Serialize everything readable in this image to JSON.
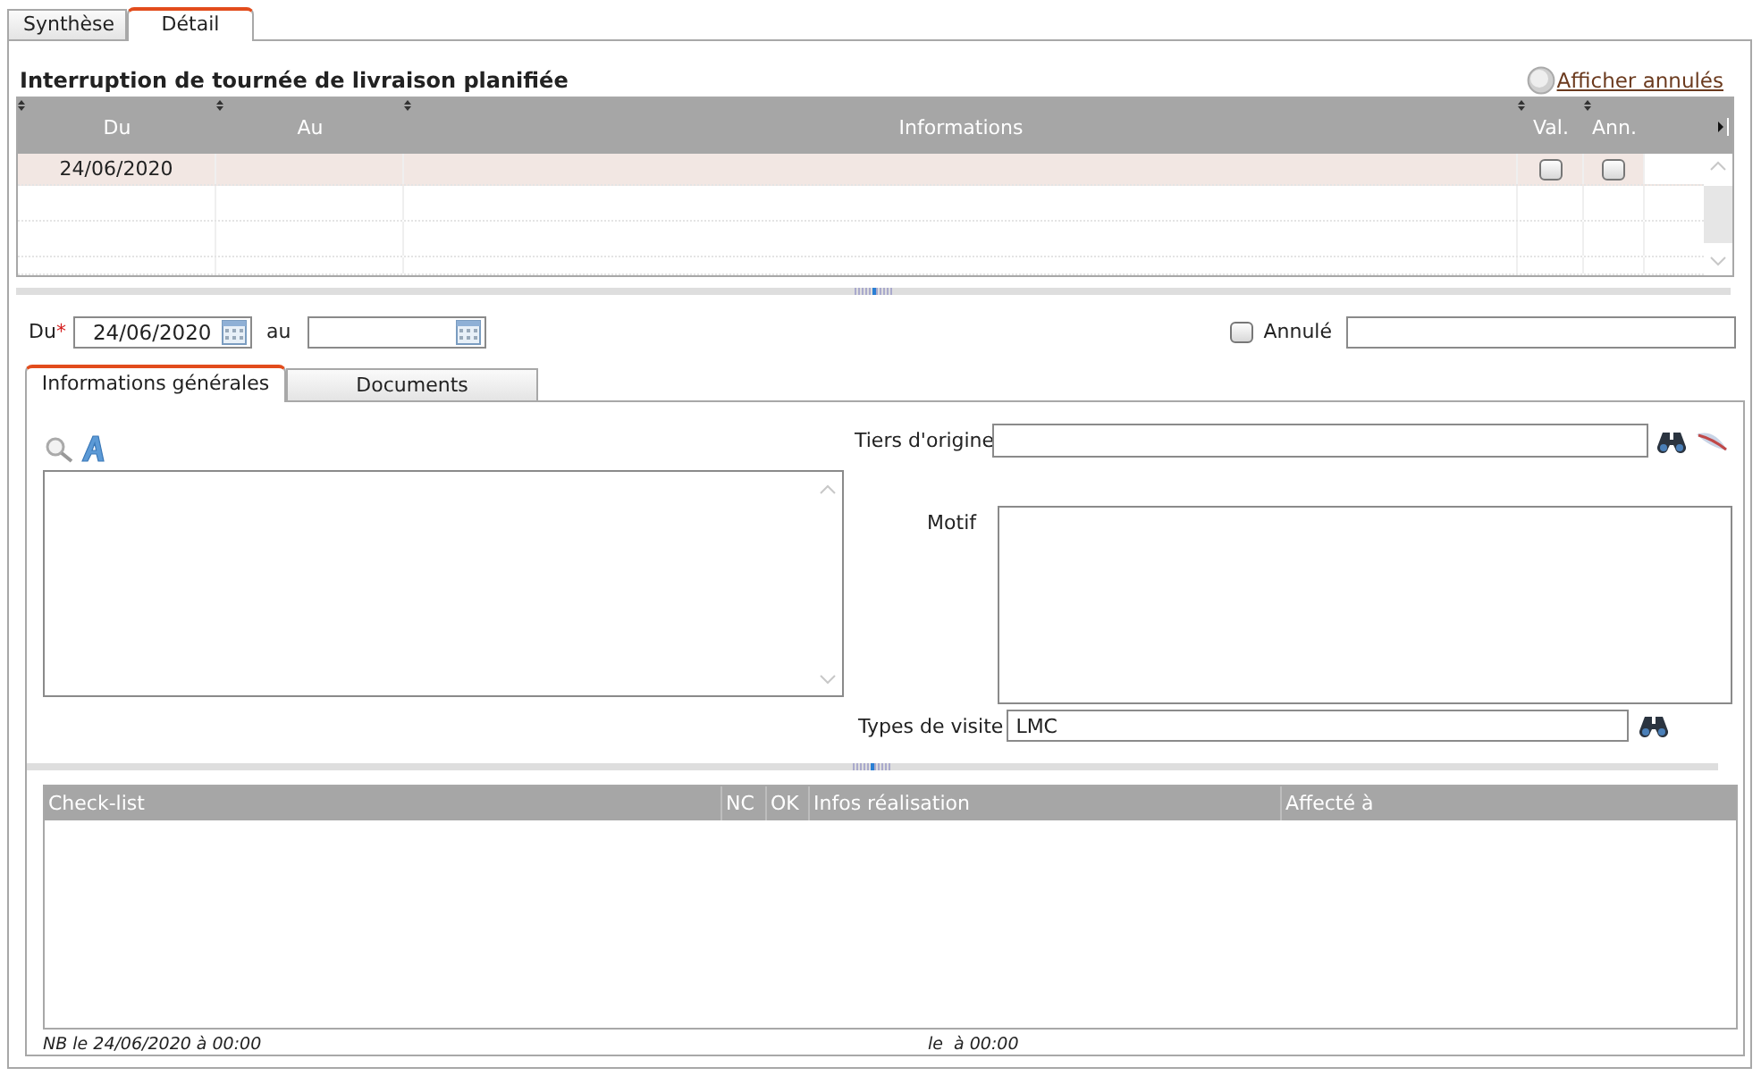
{
  "tabs": [
    {
      "label": "Synthèse",
      "selected": false
    },
    {
      "label": "Détail",
      "selected": true
    }
  ],
  "section": {
    "title": "Interruption de tournée de livraison planifiée",
    "link": "Afficher annulés"
  },
  "grid": {
    "columns": [
      "Du",
      "Au",
      "Informations",
      "Val.",
      "Ann."
    ],
    "rows": [
      {
        "du": "24/06/2020",
        "val": false,
        "ann": false,
        "selected": true
      }
    ]
  },
  "form": {
    "du": {
      "label": "Du",
      "required_mark": "*",
      "value": "24/06/2020"
    },
    "au": {
      "label": "au"
    },
    "annule": {
      "label": "Annulé",
      "checked": false
    }
  },
  "inner_tabs": [
    {
      "label": "Informations générales",
      "selected": true
    },
    {
      "label": "Documents",
      "selected": false
    }
  ],
  "fields": {
    "tiers": {
      "label": "Tiers d'origine"
    },
    "motif": {
      "label": "Motif"
    },
    "types": {
      "label": "Types de visite",
      "value": "LMC"
    }
  },
  "checklist": {
    "columns": [
      "Check-list",
      "NC",
      "OK",
      "Infos réalisation",
      "Affecté à"
    ]
  },
  "footer": [
    "NB le 24/06/2020 à 00:00",
    "le  à 00:00"
  ]
}
